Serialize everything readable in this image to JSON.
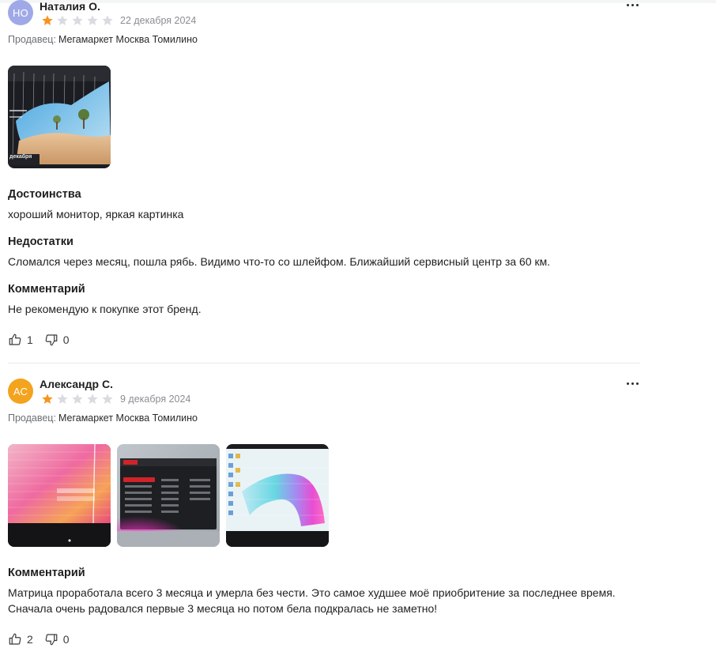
{
  "reviews": [
    {
      "initials": "НО",
      "avatar_color": "#9fa9e8",
      "author": "Наталия О.",
      "rating": 1,
      "date": "22 декабря 2024",
      "seller_label": "Продавец:",
      "seller_name": "Мегамаркет Москва Томилино",
      "photos": [
        {
          "kind": "desktop",
          "caption": "декабря"
        }
      ],
      "advantages_title": "Достоинства",
      "advantages_text": "хороший монитор, яркая картинка",
      "disadvantages_title": "Недостатки",
      "disadvantages_text": "Сломался через месяц, пошла рябь. Видимо что-то со шлейфом. Ближайший сервисный центр за 60 км.",
      "comment_title": "Комментарий",
      "comment_text": "Не рекомендую к покупке этот бренд.",
      "likes": "1",
      "dislikes": "0"
    },
    {
      "initials": "АС",
      "avatar_color": "#f3a31e",
      "author": "Александр С.",
      "rating": 1,
      "date": "9 декабря 2024",
      "seller_label": "Продавец:",
      "seller_name": "Мегамаркет Москва Томилино",
      "photos": [
        {
          "kind": "pink-glitch"
        },
        {
          "kind": "msi-menu"
        },
        {
          "kind": "color-smear"
        }
      ],
      "comment_title": "Комментарий",
      "comment_text": "Матрица проработала всего 3 месяца и умерла без чести. Это самое худшее моё приобритение за последнее время. Сначала очень радовался первые 3 месяца но потом бела подкралась не заметно!",
      "likes": "2",
      "dislikes": "0"
    }
  ],
  "colors": {
    "star_filled": "#f7931e",
    "star_empty": "#d9dbe0"
  }
}
